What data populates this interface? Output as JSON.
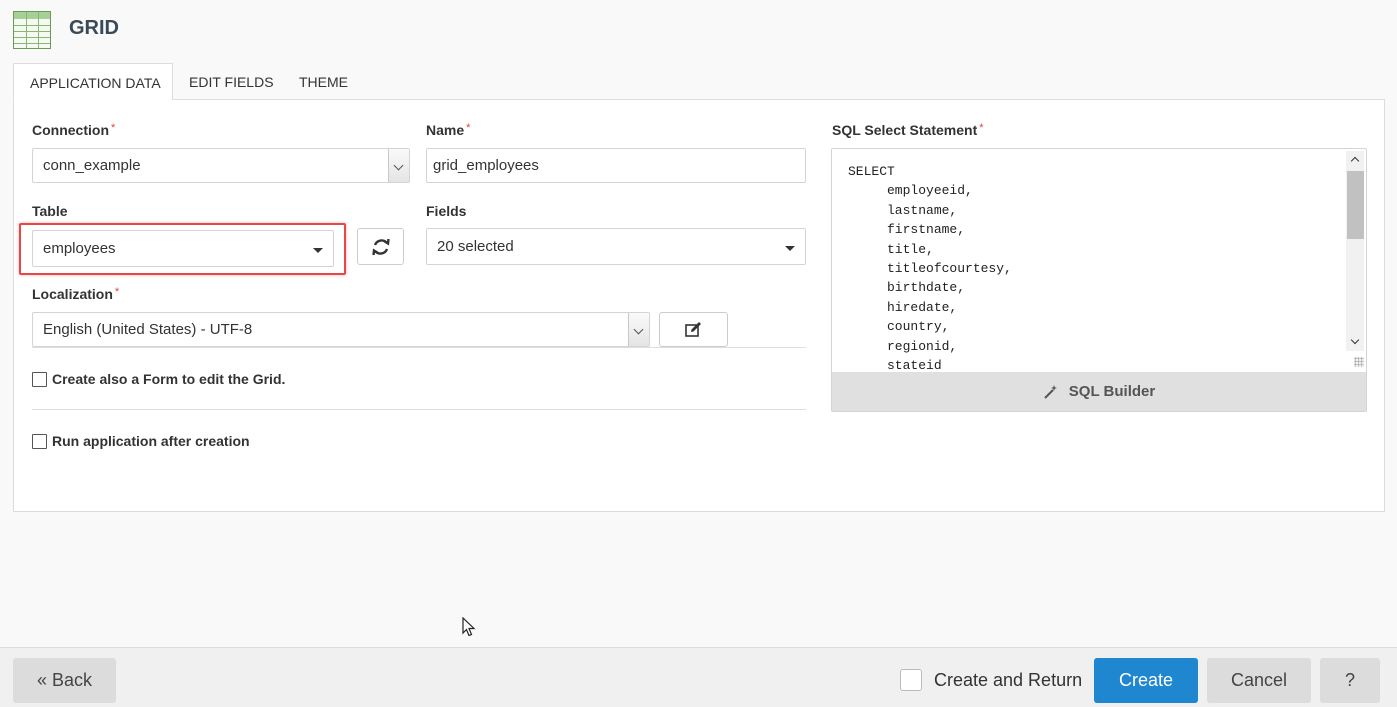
{
  "header": {
    "title": "GRID",
    "icon": "spreadsheet-grid-icon"
  },
  "tabs": [
    {
      "label": "APPLICATION DATA",
      "active": true
    },
    {
      "label": "EDIT FIELDS",
      "active": false
    },
    {
      "label": "THEME",
      "active": false
    }
  ],
  "form": {
    "connection": {
      "label": "Connection",
      "required": "*",
      "value": "conn_example"
    },
    "name": {
      "label": "Name",
      "required": "*",
      "value": "grid_employees"
    },
    "table": {
      "label": "Table",
      "value": "employees",
      "refresh_icon": "refresh-icon"
    },
    "fields": {
      "label": "Fields",
      "value": "20 selected"
    },
    "localization": {
      "label": "Localization",
      "required": "*",
      "value": "English (United States) - UTF-8",
      "edit_icon": "edit-icon"
    },
    "create_form_label": "Create also a Form to edit the Grid.",
    "create_form_checked": false,
    "run_after_label": "Run application after creation",
    "run_after_checked": false
  },
  "sql": {
    "label": "SQL Select Statement",
    "required": "*",
    "text": "SELECT\n     employeeid,\n     lastname,\n     firstname,\n     title,\n     titleofcourtesy,\n     birthdate,\n     hiredate,\n     country,\n     regionid,\n     stateid",
    "builder_label": "SQL Builder",
    "builder_icon": "magic-wand-icon"
  },
  "footer": {
    "back_label": "« Back",
    "create_return_label": "Create and Return",
    "create_return_checked": false,
    "create_label": "Create",
    "cancel_label": "Cancel",
    "help_label": "?"
  },
  "colors": {
    "primary": "#1f86d0",
    "required": "#e04040",
    "highlight": "#e8474a"
  }
}
